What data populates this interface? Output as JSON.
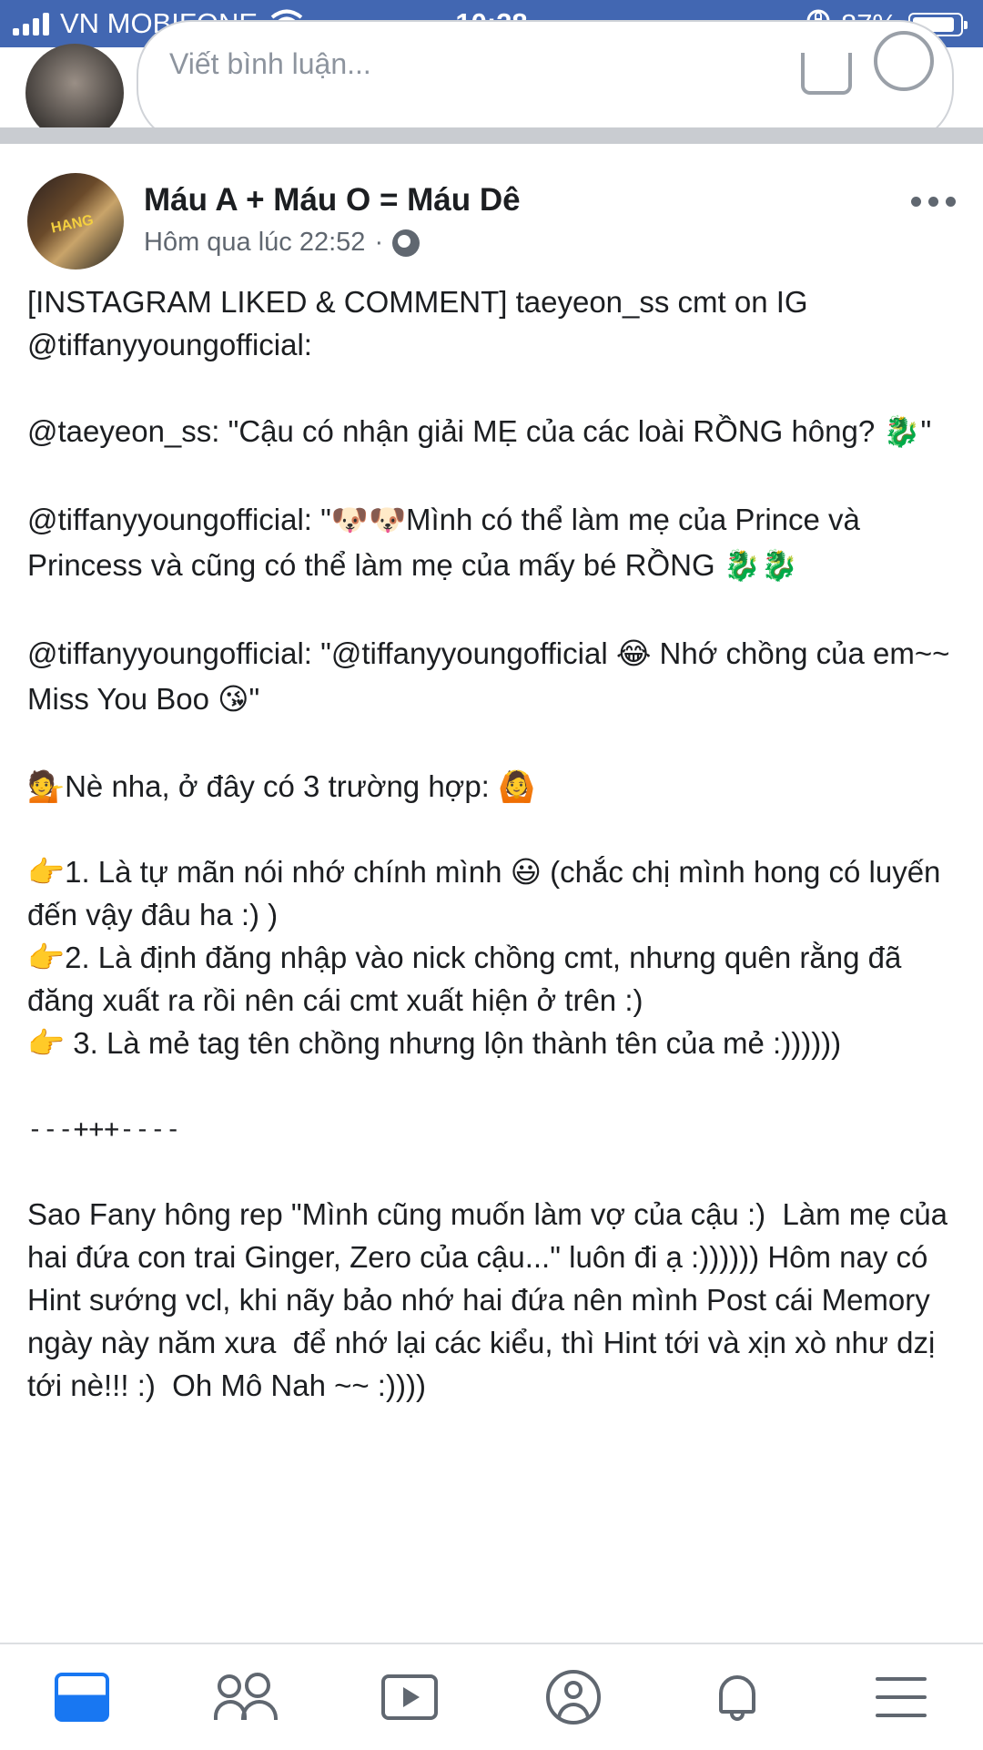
{
  "status_bar": {
    "carrier": "VN MOBIFONE",
    "time": "10:28",
    "battery": "87%",
    "battery_level": 0.87
  },
  "composer": {
    "placeholder": "Viết bình luận..."
  },
  "post": {
    "author": "Máu A + Máu O = Máu Dê",
    "timestamp": "Hôm qua lúc 22:52",
    "meta_separator": "·",
    "paragraphs": [
      "[INSTAGRAM LIKED & COMMENT] taeyeon_ss cmt on IG @tiffanyyoungofficial:",
      "@taeyeon_ss: \"Cậu có nhận giải MẸ của các loài RỒNG hông? 🐉\"",
      "@tiffanyyoungofficial: \"🐶🐶Mình có thể làm mẹ của Prince và Princess và cũng có thể làm mẹ của mấy bé RỒNG 🐉🐉",
      "@tiffanyyoungofficial: \"@tiffanyyoungofficial 😂 Nhớ chồng của em~~ Miss You Boo 😘\"",
      "💁Nè nha, ở đây có 3 trường hợp: 🙆",
      "👉1. Là tự mãn nói nhớ chính mình 😃 (chắc chị mình hong có luyến đến vậy đâu ha :) )",
      "👉2. Là định đăng nhập vào nick chồng cmt, nhưng quên rằng đã đăng xuất ra rồi nên cái cmt xuất hiện ở trên :)",
      "👉 3. Là mẻ tag tên chồng nhưng lộn thành tên của mẻ :))))))",
      "---+++----",
      "Sao Fany hông rep \"Mình cũng muốn làm vợ của cậu :)  Làm mẹ của hai đứa con trai Ginger, Zero của cậu...\" luôn đi ạ :)))))) Hôm nay có Hint sướng vcl, khi nãy bảo nhớ hai đứa nên mình Post cái Memory ngày này năm xưa  để nhớ lại các kiểu, thì Hint tới và xịn xò như dzị tới nè!!! :)  Oh Mô Nah ~~ :))))"
    ]
  },
  "colors": {
    "status_bar": "#4267b2",
    "accent": "#1877f2",
    "icon_gray": "#606770",
    "text": "#1c1e21"
  },
  "bottom_nav": {
    "items": [
      "news-feed",
      "friends",
      "watch",
      "profile",
      "notifications",
      "menu"
    ],
    "active": "news-feed"
  }
}
